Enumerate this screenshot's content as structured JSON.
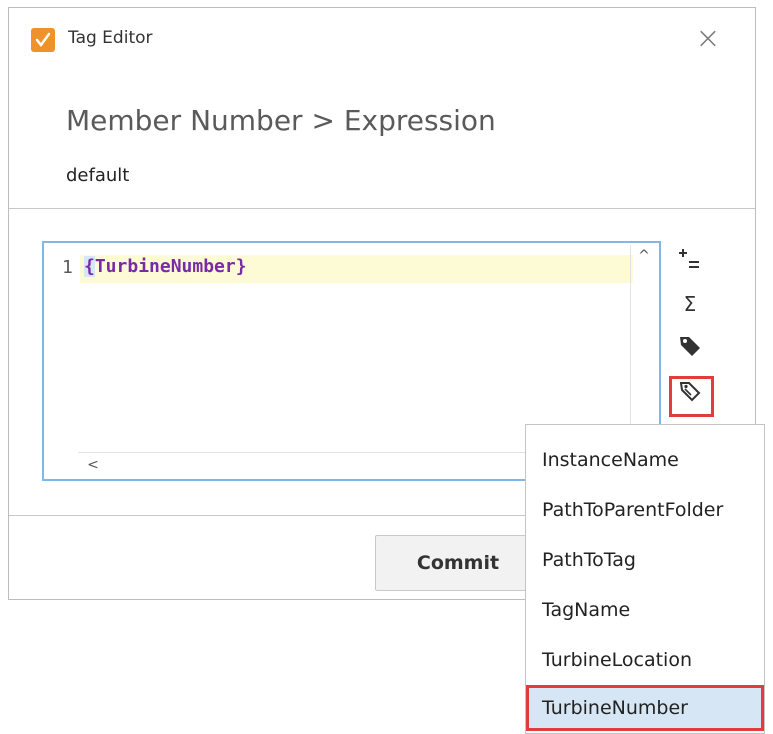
{
  "window": {
    "title": "Tag Editor",
    "app_icon": "pencil-app-icon",
    "close_icon": "close-icon"
  },
  "header": {
    "breadcrumb": "Member Number > Expression",
    "subtitle": "default"
  },
  "editor": {
    "line_number": "1",
    "brace_open": "{",
    "code_rest": "TurbineNumber}",
    "scroll_up": "^",
    "scroll_left": "<"
  },
  "side_icons": [
    "add-property-icon",
    "sigma-icon",
    "tag-icon",
    "tag-outline-icon"
  ],
  "footer": {
    "commit_label": "Commit"
  },
  "menu": {
    "items": [
      {
        "label": "InstanceName"
      },
      {
        "label": "PathToParentFolder"
      },
      {
        "label": "PathToTag"
      },
      {
        "label": "TagName"
      },
      {
        "label": "TurbineLocation"
      },
      {
        "label": "TurbineNumber",
        "selected": true
      }
    ]
  },
  "colors": {
    "accent": "#e23c3c",
    "brand": "#f0922c",
    "code": "#7a2aa8",
    "highlight": "#fcfbd6",
    "focus": "#7fb7e6"
  }
}
